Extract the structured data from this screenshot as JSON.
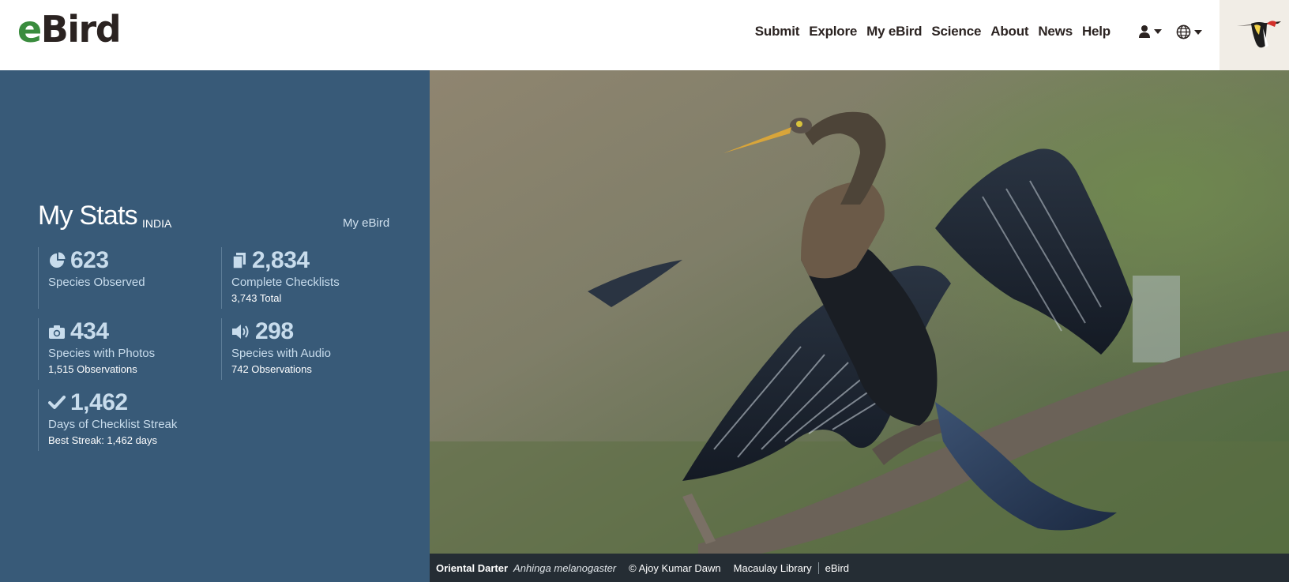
{
  "header": {
    "logo_prefix": "e",
    "logo_suffix": "Bird",
    "nav": [
      "Submit",
      "Explore",
      "My eBird",
      "Science",
      "About",
      "News",
      "Help"
    ]
  },
  "stats": {
    "title": "My Stats",
    "region": "INDIA",
    "link": "My eBird",
    "items": [
      {
        "icon": "pie-chart-icon",
        "value": "623",
        "label": "Species Observed",
        "sub": ""
      },
      {
        "icon": "checklist-icon",
        "value": "2,834",
        "label": "Complete Checklists",
        "sub": "3,743 Total"
      },
      {
        "icon": "camera-icon",
        "value": "434",
        "label": "Species with Photos",
        "sub": "1,515 Observations"
      },
      {
        "icon": "speaker-icon",
        "value": "298",
        "label": "Species with Audio",
        "sub": "742 Observations"
      },
      {
        "icon": "checkmark-icon",
        "value": "1,462",
        "label": "Days of Checklist Streak",
        "sub": "Best Streak: 1,462 days"
      }
    ]
  },
  "hero": {
    "subject": "Oriental Darter perched on branch with wings spread"
  },
  "caption": {
    "common_name": "Oriental Darter",
    "scientific_name": "Anhinga melanogaster",
    "credit": "© Ajoy Kumar Dawn",
    "library": "Macaulay Library",
    "source": "eBird"
  },
  "colors": {
    "panel_bg": "#385a78",
    "brand_green": "#3a8c3e",
    "caption_bg": "#252d34"
  }
}
